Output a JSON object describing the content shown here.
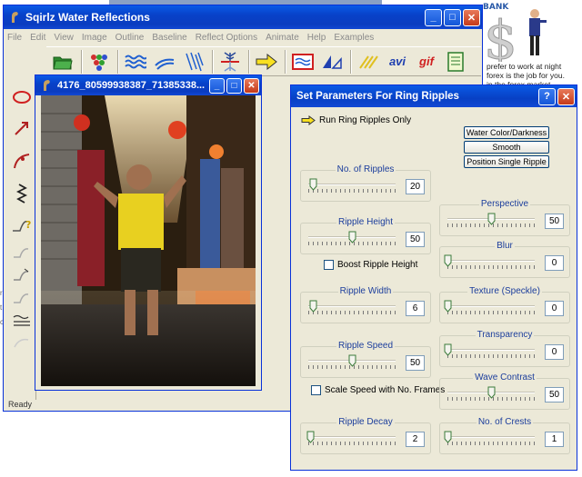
{
  "background": {
    "bank_title": "BANK",
    "lines": [
      "prefer to work at night",
      "forex is the job for you.",
      "in the forex market"
    ],
    "fragments": [
      "r",
      "t",
      "c"
    ]
  },
  "app": {
    "title": "Sqirlz Water Reflections",
    "menu": [
      "File",
      "Edit",
      "View",
      "Image",
      "Outline",
      "Baseline",
      "Reflect Options",
      "Animate",
      "Help",
      "Examples"
    ],
    "toolbar_text": {
      "avi": "avi",
      "gif": "gif"
    },
    "status": "Ready"
  },
  "image_window": {
    "title": "4176_80599938387_71385338..."
  },
  "dialog": {
    "title": "Set Parameters For Ring Ripples",
    "run_label": "Run Ring Ripples Only",
    "buttons": {
      "water_color": "Water Color/Darkness",
      "smooth": "Smooth",
      "position_single": "Position Single Ripple"
    },
    "left": [
      {
        "label": "No. of Ripples",
        "value": "20",
        "pos": 0.05
      },
      {
        "label": "Ripple Height",
        "value": "50",
        "pos": 0.5
      },
      {
        "label": "Ripple Width",
        "value": "6",
        "pos": 0.05
      },
      {
        "label": "Ripple Speed",
        "value": "50",
        "pos": 0.5
      },
      {
        "label": "Ripple Decay",
        "value": "2",
        "pos": 0.02
      }
    ],
    "right": [
      {
        "label": "Perspective",
        "value": "50",
        "pos": 0.5
      },
      {
        "label": "Blur",
        "value": "0",
        "pos": 0.0
      },
      {
        "label": "Texture (Speckle)",
        "value": "0",
        "pos": 0.0
      },
      {
        "label": "Transparency",
        "value": "0",
        "pos": 0.0
      },
      {
        "label": "Wave Contrast",
        "value": "50",
        "pos": 0.5
      },
      {
        "label": "No. of Crests",
        "value": "1",
        "pos": 0.0
      }
    ],
    "checks": {
      "boost": "Boost Ripple Height",
      "scale_speed": "Scale Speed with No. Frames"
    }
  },
  "colors": {
    "title_blue": "#0a4be0",
    "dialog_face": "#ece9d8",
    "group_label": "#1c3e9c"
  }
}
